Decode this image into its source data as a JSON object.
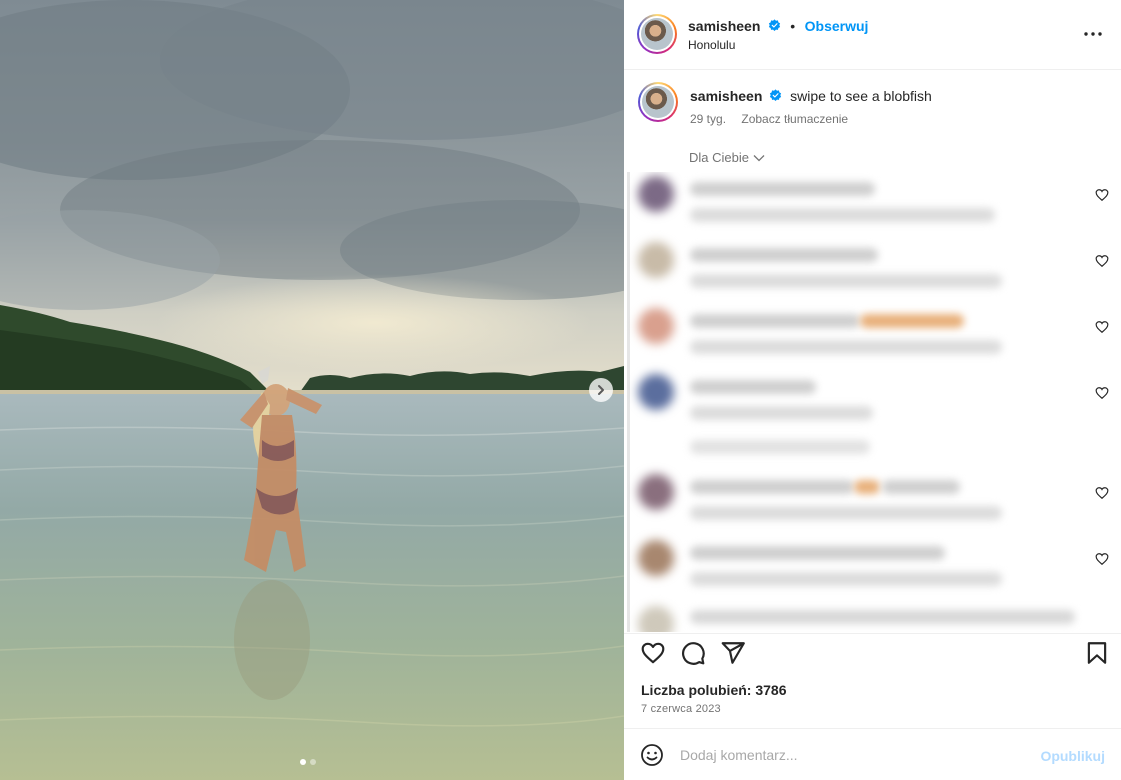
{
  "post": {
    "username": "samisheen",
    "verified": true,
    "follow_label": "Obserwuj",
    "location": "Honolulu",
    "separator": "•"
  },
  "caption": {
    "username": "samisheen",
    "text": "swipe to see a blobfish",
    "age": "29 tyg.",
    "translate_label": "Zobacz tłumaczenie"
  },
  "comments_section": {
    "filter_label": "Dla Ciebie",
    "comments_blurred": true
  },
  "actions": {
    "likes_text": "Liczba polubień: 3786",
    "date": "7 czerwca 2023"
  },
  "comment_box": {
    "placeholder": "Dodaj komentarz...",
    "publish_label": "Opublikuj"
  },
  "carousel": {
    "slide_count": 2,
    "current_slide": 1
  },
  "icons": {
    "verified": "verified-badge-icon",
    "more": "more-options-icon",
    "like": "heart-icon",
    "comment": "comment-icon",
    "share": "share-icon",
    "save": "bookmark-icon",
    "emoji": "emoji-icon",
    "next": "chevron-right-icon"
  },
  "colors": {
    "accent": "#0095f6",
    "verified": "#0095f6",
    "muted_text": "#737373",
    "publish_disabled": "#b3dbff"
  }
}
